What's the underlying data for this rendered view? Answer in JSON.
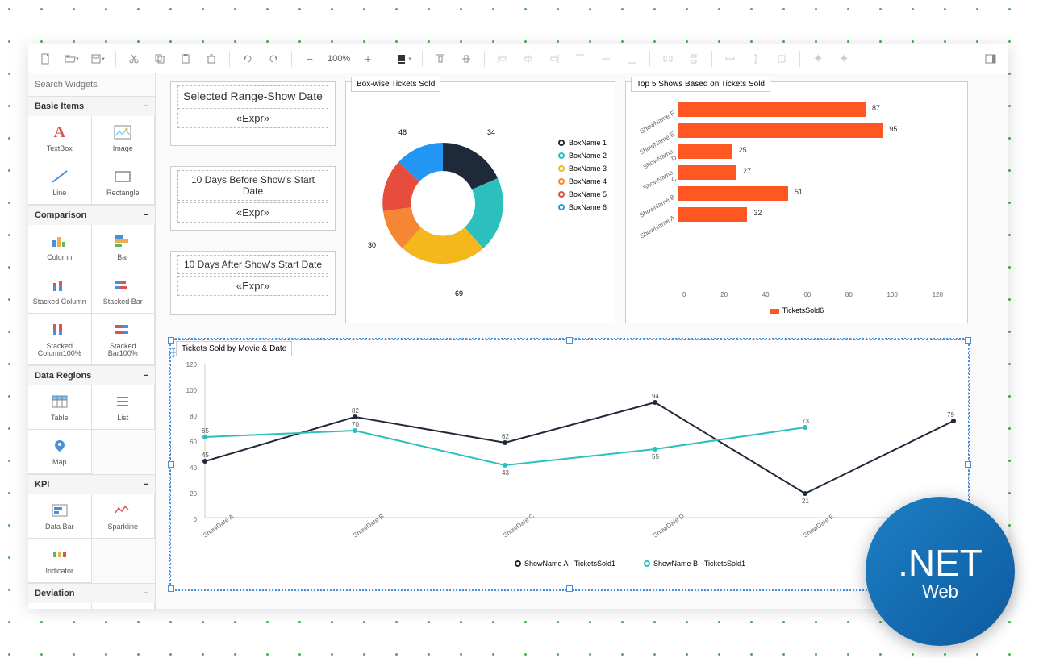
{
  "toolbar": {
    "zoom": "100%"
  },
  "sidebar": {
    "search_placeholder": "Search Widgets",
    "sections": {
      "basic": {
        "title": "Basic Items",
        "items": [
          "TextBox",
          "Image",
          "Line",
          "Rectangle"
        ]
      },
      "comparison": {
        "title": "Comparison",
        "items": [
          "Column",
          "Bar",
          "Stacked Column",
          "Stacked Bar",
          "Stacked Column100%",
          "Stacked Bar100%"
        ]
      },
      "data_regions": {
        "title": "Data Regions",
        "items": [
          "Table",
          "List",
          "Map"
        ]
      },
      "kpi": {
        "title": "KPI",
        "items": [
          "Data Bar",
          "Sparkline",
          "Indicator"
        ]
      },
      "deviation": {
        "title": "Deviation"
      }
    }
  },
  "cards": {
    "range": {
      "title": "Selected Range-Show Date",
      "expr": "«Expr»"
    },
    "before": {
      "title": "10 Days Before Show's Start Date",
      "expr": "«Expr»"
    },
    "after": {
      "title": "10 Days After Show's Start Date",
      "expr": "«Expr»"
    }
  },
  "donut": {
    "title": "Box-wise Tickets Sold",
    "legend": [
      "BoxName 1",
      "BoxName 2",
      "BoxName 3",
      "BoxName 4",
      "BoxName 5",
      "BoxName 6"
    ],
    "labels": {
      "v48": "48",
      "v34": "34",
      "v69": "69",
      "v30": "30"
    }
  },
  "hbar": {
    "title": "Top 5 Shows Based on Tickets Sold",
    "legend": "TicketsSold6",
    "ticks": [
      "0",
      "20",
      "40",
      "60",
      "80",
      "100",
      "120"
    ]
  },
  "line": {
    "title": "Tickets Sold by Movie & Date",
    "legend": [
      "ShowName A - TicketsSold1",
      "ShowName B - TicketsSold1"
    ],
    "yticks": [
      "120",
      "100",
      "80",
      "60",
      "40",
      "20",
      "0"
    ],
    "xticks": [
      "ShowDate A",
      "ShowDate B",
      "ShowDate C",
      "ShowDate D",
      "ShowDate E"
    ]
  },
  "badge": {
    "title": ".NET",
    "sub": "Web"
  },
  "chart_data": [
    {
      "type": "pie",
      "title": "Box-wise Tickets Sold",
      "categories": [
        "BoxName 1",
        "BoxName 2",
        "BoxName 3",
        "BoxName 4",
        "BoxName 5",
        "BoxName 6"
      ],
      "values": [
        34,
        55,
        69,
        35,
        30,
        48
      ],
      "labels_shown": [
        48,
        34,
        69,
        30
      ]
    },
    {
      "type": "bar",
      "title": "Top 5 Shows Based on Tickets Sold",
      "orientation": "horizontal",
      "categories": [
        "ShowName F",
        "ShowName E",
        "ShowName D",
        "ShowName C",
        "ShowName B",
        "ShowName A"
      ],
      "values": [
        87,
        95,
        25,
        27,
        51,
        32
      ],
      "xlim": [
        0,
        120
      ],
      "legend": [
        "TicketsSold6"
      ]
    },
    {
      "type": "line",
      "title": "Tickets Sold by Movie & Date",
      "x": [
        "ShowDate A",
        "ShowDate B",
        "ShowDate C",
        "ShowDate D",
        "ShowDate E",
        "(end)"
      ],
      "series": [
        {
          "name": "ShowName A - TicketsSold1",
          "values": [
            45,
            82,
            62,
            94,
            21,
            79
          ]
        },
        {
          "name": "ShowName B - TicketsSold1",
          "values": [
            65,
            70,
            43,
            55,
            73,
            null
          ]
        }
      ],
      "ylim": [
        0,
        120
      ]
    }
  ]
}
